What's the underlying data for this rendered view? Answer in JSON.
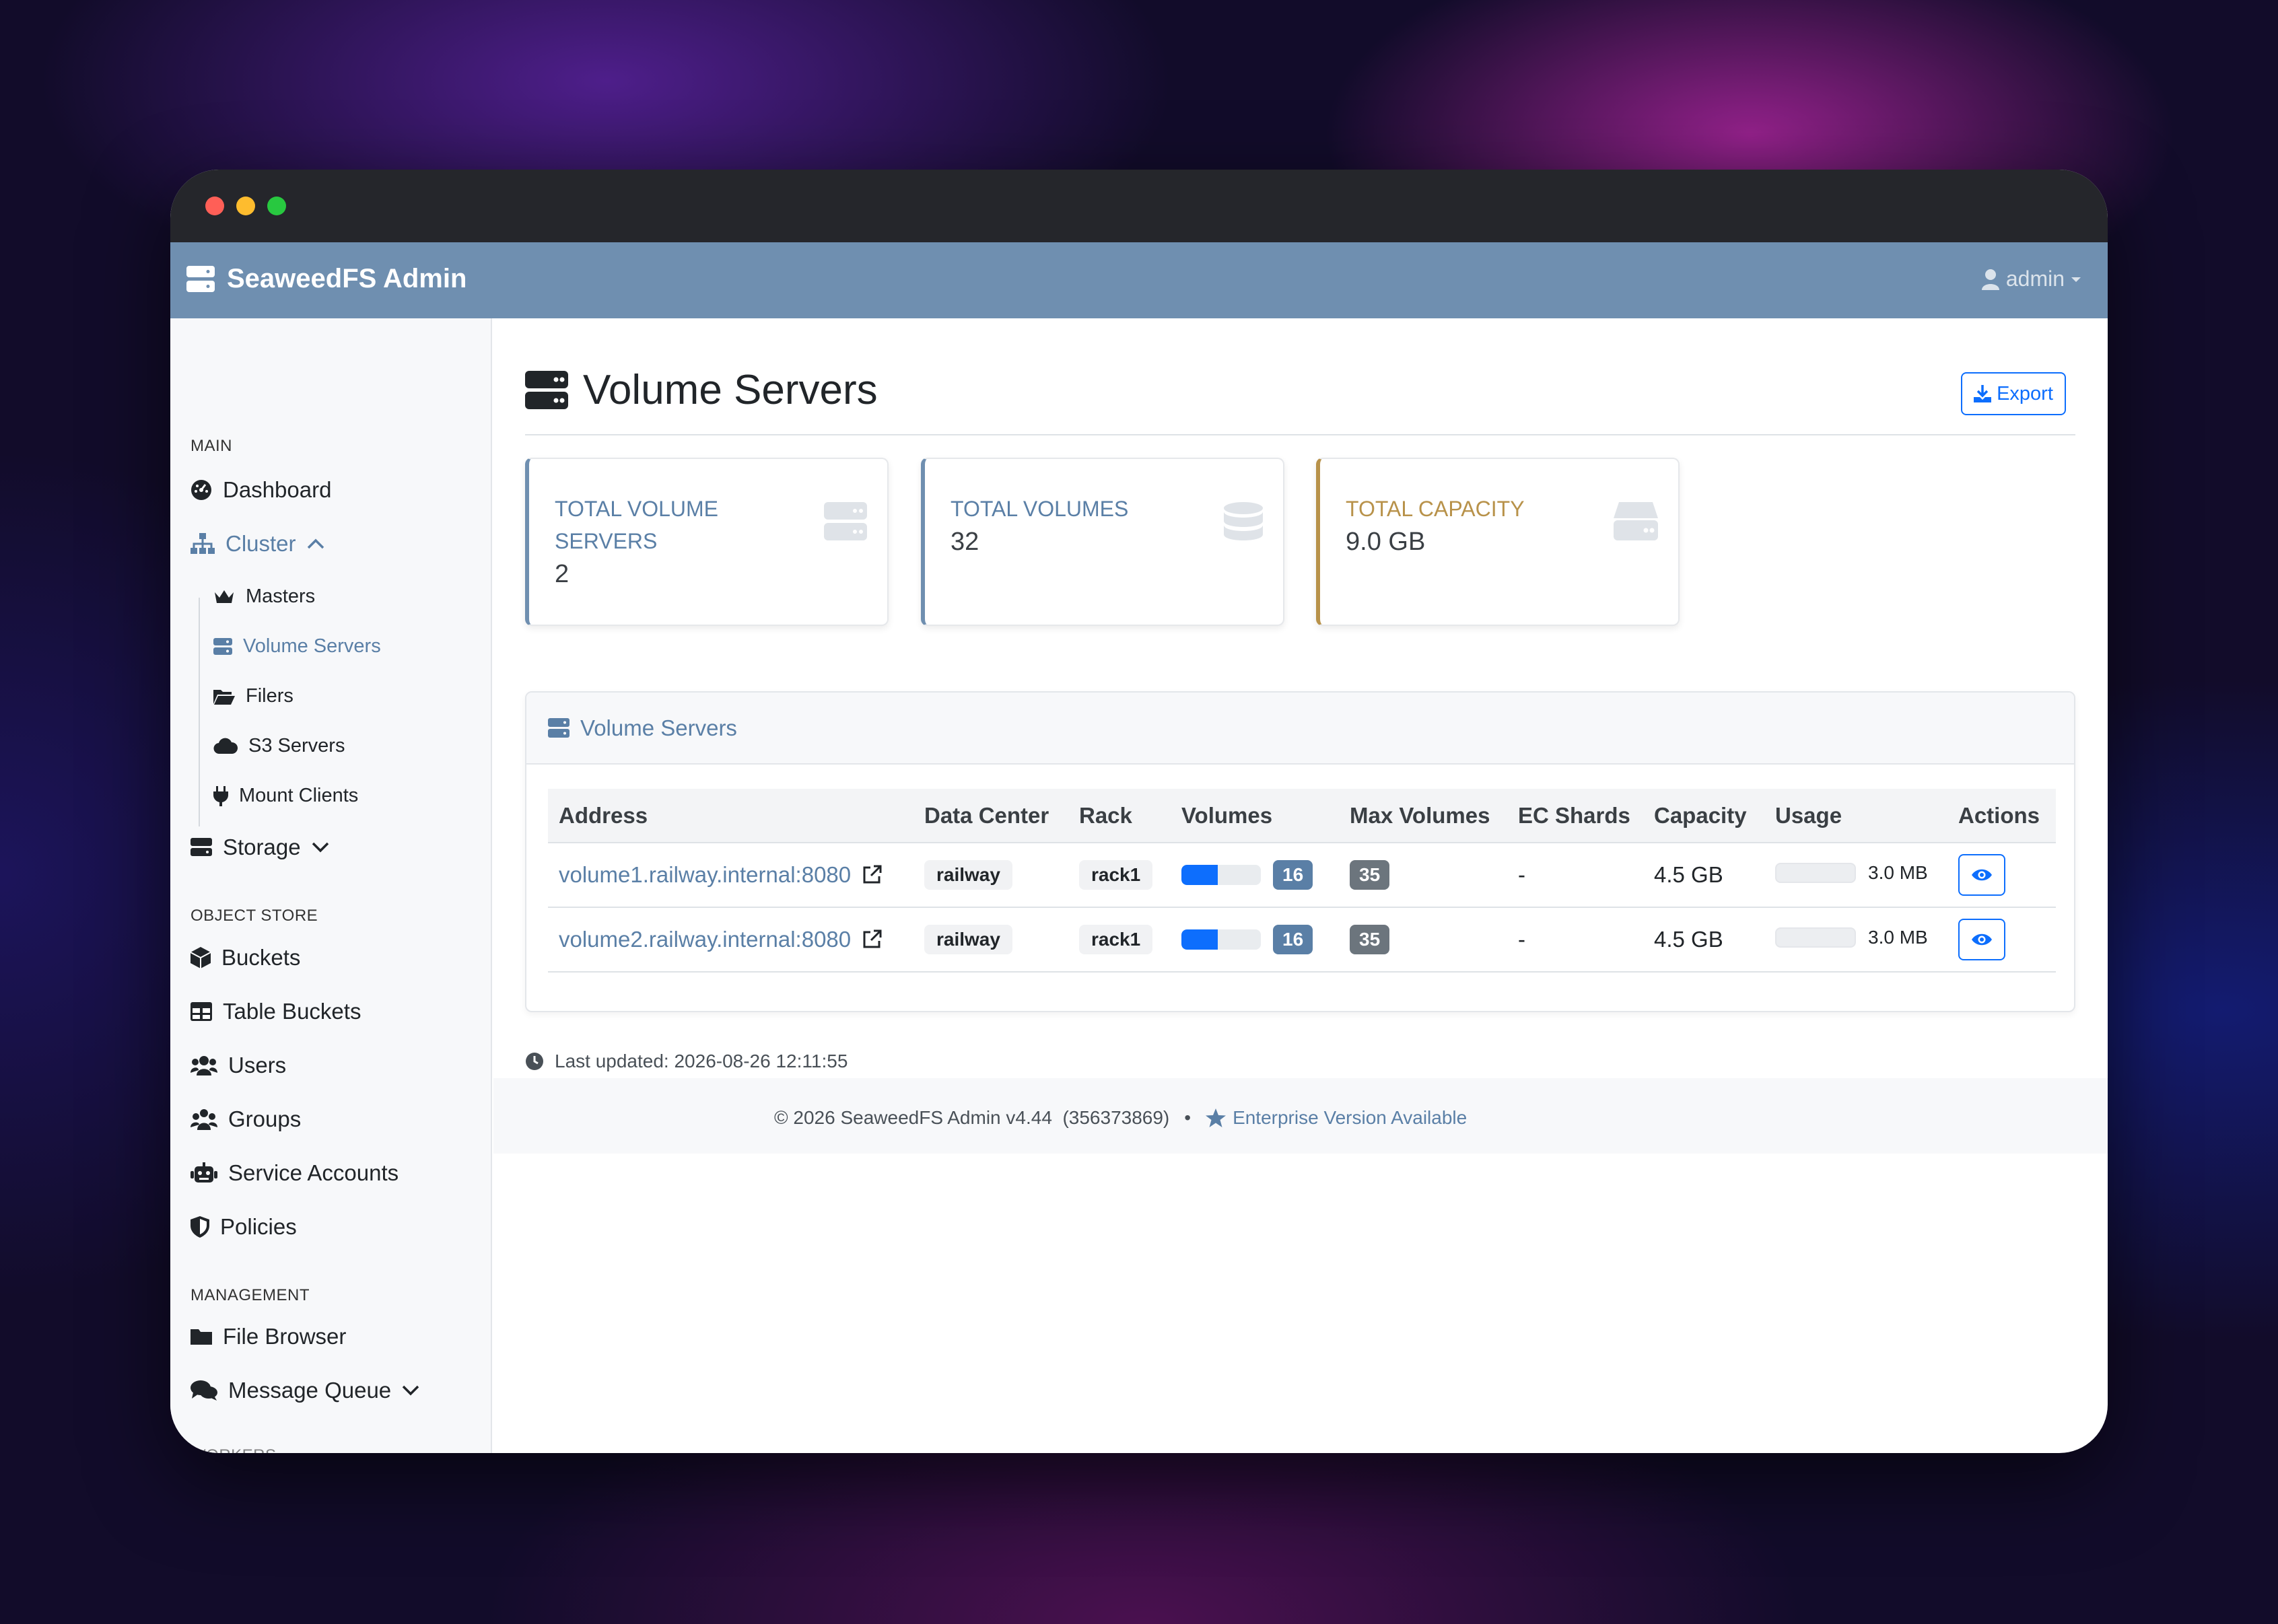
{
  "app": {
    "brand": "SeaweedFS Admin",
    "user": "admin"
  },
  "sidebar": {
    "sections": {
      "main": "MAIN",
      "object_store": "OBJECT STORE",
      "management": "MANAGEMENT",
      "workers_partial": "WORKERS"
    },
    "items": {
      "dashboard": "Dashboard",
      "cluster": "Cluster",
      "masters": "Masters",
      "volume_servers": "Volume Servers",
      "filers": "Filers",
      "s3_servers": "S3 Servers",
      "mount_clients": "Mount Clients",
      "storage": "Storage",
      "buckets": "Buckets",
      "table_buckets": "Table Buckets",
      "users": "Users",
      "groups": "Groups",
      "service_accounts": "Service Accounts",
      "policies": "Policies",
      "file_browser": "File Browser",
      "message_queue": "Message Queue"
    }
  },
  "page": {
    "title": "Volume Servers",
    "export_label": "Export"
  },
  "stats": [
    {
      "label": "TOTAL VOLUME SERVERS",
      "value": "2",
      "color": "#5a7fa6"
    },
    {
      "label": "TOTAL VOLUMES",
      "value": "32",
      "color": "#5a7fa6"
    },
    {
      "label": "TOTAL CAPACITY",
      "value": "9.0 GB",
      "color": "#b8924a"
    }
  ],
  "panel": {
    "title": "Volume Servers",
    "columns": [
      "Address",
      "Data Center",
      "Rack",
      "Volumes",
      "Max Volumes",
      "EC Shards",
      "Capacity",
      "Usage",
      "Actions"
    ],
    "rows": [
      {
        "address": "volume1.railway.internal:8080",
        "datacenter": "railway",
        "rack": "rack1",
        "volumes": "16",
        "volume_fraction": 0.46,
        "max_volumes": "35",
        "ec_shards": "-",
        "capacity": "4.5 GB",
        "usage": "3.0 MB"
      },
      {
        "address": "volume2.railway.internal:8080",
        "datacenter": "railway",
        "rack": "rack1",
        "volumes": "16",
        "volume_fraction": 0.46,
        "max_volumes": "35",
        "ec_shards": "-",
        "capacity": "4.5 GB",
        "usage": "3.0 MB"
      }
    ]
  },
  "footer": {
    "last_updated": "Last updated: 2026-08-26 12:11:55",
    "copyright": "© 2026 SeaweedFS Admin v4.44  (356373869)",
    "separator": "•",
    "enterprise": "Enterprise Version Available"
  },
  "colors": {
    "accent": "#5a7fa6",
    "primary": "#0d6efd",
    "navbar": "#6f8fb0",
    "capacity": "#b8924a"
  }
}
